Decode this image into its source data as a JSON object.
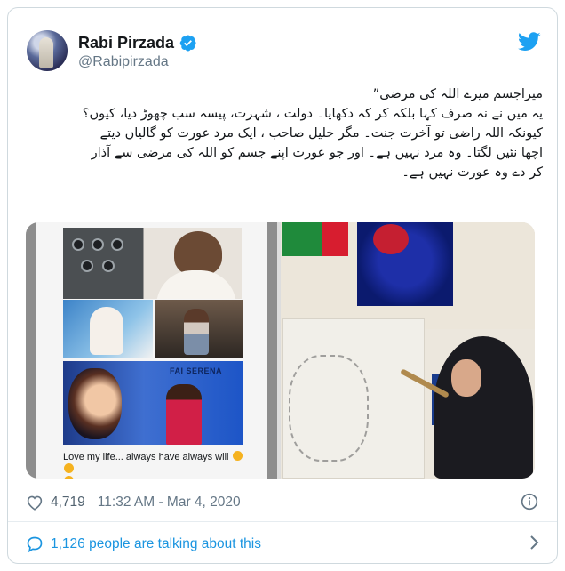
{
  "author": {
    "name": "Rabi Pirzada",
    "handle": "@Rabipirzada",
    "verified_color": "#1da1f2"
  },
  "icons": {
    "brand": "twitter-bird-icon",
    "verified": "verified-badge-icon",
    "like": "heart-icon",
    "info": "info-icon",
    "talk": "speech-bubble-icon",
    "more": "chevron-right-icon"
  },
  "tweet": {
    "lines": [
      "میراجسم میرے اللہ کی مرضی”",
      "یہ میں نے نہ صرف کہا بلکہ کر کہ دکھایا۔ دولت ، شہرت، پیسہ سب  چھوڑ دیا، کیوں؟",
      "کیونکہ اللہ راضی تو آخرت جنت۔ مگر خلیل صاحب ، ایک مرد عورت کو گالیاں دیتے",
      "اچھا نئیں لگتا۔ وہ مرد نہیں ہے۔ اور جو عورت اپنے جسم کو اللہ کی مرضی سے آذار",
      "کر دے وہ عورت نہیں ہے۔"
    ]
  },
  "media": {
    "collage_label": "FAI  SERENA",
    "caption": "Love my life... always have always will"
  },
  "footer": {
    "likes": "4,719",
    "timestamp": "11:32 AM - Mar 4, 2020",
    "talking": "1,126 people are talking about this"
  },
  "colors": {
    "brand_blue": "#1da1f2",
    "link_blue": "#1b95e0",
    "muted": "#657786"
  }
}
